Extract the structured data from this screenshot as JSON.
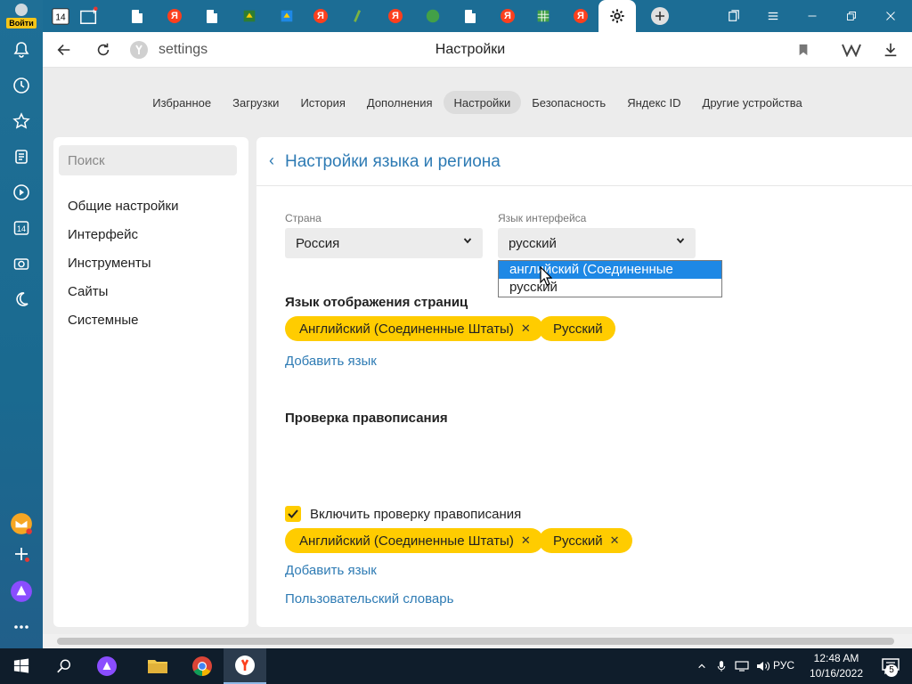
{
  "sidebar": {
    "login_label": "Войти",
    "calendar_day": "14"
  },
  "tabs": {
    "first_day": "14"
  },
  "address_bar": {
    "url": "settings",
    "title": "Настройки"
  },
  "settings_nav": {
    "items": [
      "Избранное",
      "Загрузки",
      "История",
      "Дополнения",
      "Настройки",
      "Безопасность",
      "Яндекс ID",
      "Другие устройства"
    ],
    "active": "Настройки"
  },
  "left_panel": {
    "search_placeholder": "Поиск",
    "items": [
      "Общие настройки",
      "Интерфейс",
      "Инструменты",
      "Сайты",
      "Системные"
    ]
  },
  "main": {
    "title": "Настройки языка и региона",
    "country_label": "Страна",
    "country_value": "Россия",
    "ui_lang_label": "Язык интерфейса",
    "ui_lang_value": "русский",
    "page_lang_heading": "Язык отображения страниц",
    "page_lang_chips": [
      "Английский (Соединенные Штаты)",
      "Русский"
    ],
    "add_lang_1": "Добавить язык",
    "spell_heading": "Проверка правописания",
    "spell_checkbox_label": "Включить проверку правописания",
    "spell_checked": true,
    "spell_chips": [
      "Английский (Соединенные Штаты)",
      "Русский"
    ],
    "add_lang_2": "Добавить язык",
    "user_dict": "Пользовательский словарь"
  },
  "dropdown": {
    "options": [
      "английский (Соединенные Штаты)",
      "русский"
    ],
    "highlighted": "английский (Соединенные Штаты)"
  },
  "taskbar": {
    "lang": "РУС",
    "time": "12:48 AM",
    "date": "10/16/2022",
    "notifications": "5"
  },
  "colors": {
    "accent_yellow": "#ffcc00",
    "link_blue": "#2e7bb4",
    "chrome_blue": "#1c6d95",
    "selection_blue": "#1e88e5"
  }
}
